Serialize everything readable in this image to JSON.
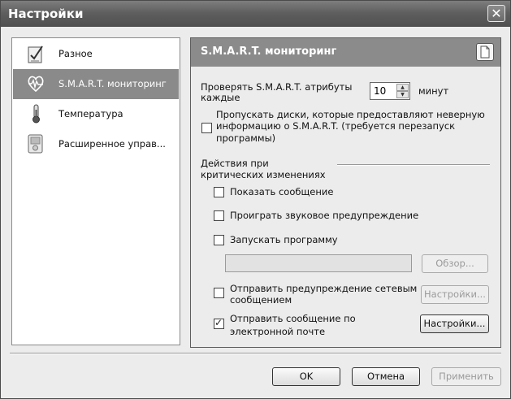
{
  "window": {
    "title": "Настройки",
    "close_symbol": "✕"
  },
  "sidebar": {
    "items": [
      {
        "label": "Разное",
        "icon": "checklist-icon",
        "selected": false
      },
      {
        "label": "S.M.A.R.T. мониторинг",
        "icon": "heartbeat-icon",
        "selected": true
      },
      {
        "label": "Температура",
        "icon": "thermometer-icon",
        "selected": false
      },
      {
        "label": "Расширенное управ...",
        "icon": "device-icon",
        "selected": false
      }
    ]
  },
  "panel": {
    "title": "S.M.A.R.T. мониторинг",
    "check_every_label_line1": "Проверять S.M.A.R.T. атрибуты",
    "check_every_label_line2": "каждые",
    "interval_value": "10",
    "interval_unit": "минут",
    "skip_disks": {
      "line1": "Пропускать диски, которые предоставляют неверную",
      "line2": "информацию о S.M.A.R.T. (требуется перезапуск",
      "line3": "программы)",
      "checked": false
    },
    "actions_heading_line1": "Действия при",
    "actions_heading_line2": "критических изменениях",
    "show_message": {
      "label": "Показать сообщение",
      "checked": false
    },
    "play_sound": {
      "label": "Проиграть звуковое предупреждение",
      "checked": false
    },
    "run_program": {
      "label": "Запускать программу",
      "checked": false
    },
    "program_path": "",
    "browse_label": "Обзор...",
    "net_alert": {
      "line1": "Отправить предупреждение сетевым",
      "line2": "сообщением",
      "checked": false
    },
    "net_settings_label": "Настройки...",
    "email_alert": {
      "line1": "Отправить сообщение по",
      "line2": "электронной почте",
      "checked": true
    },
    "email_settings_label": "Настройки..."
  },
  "footer": {
    "ok_label": "OK",
    "cancel_label": "Отмена",
    "apply_label": "Применить"
  }
}
